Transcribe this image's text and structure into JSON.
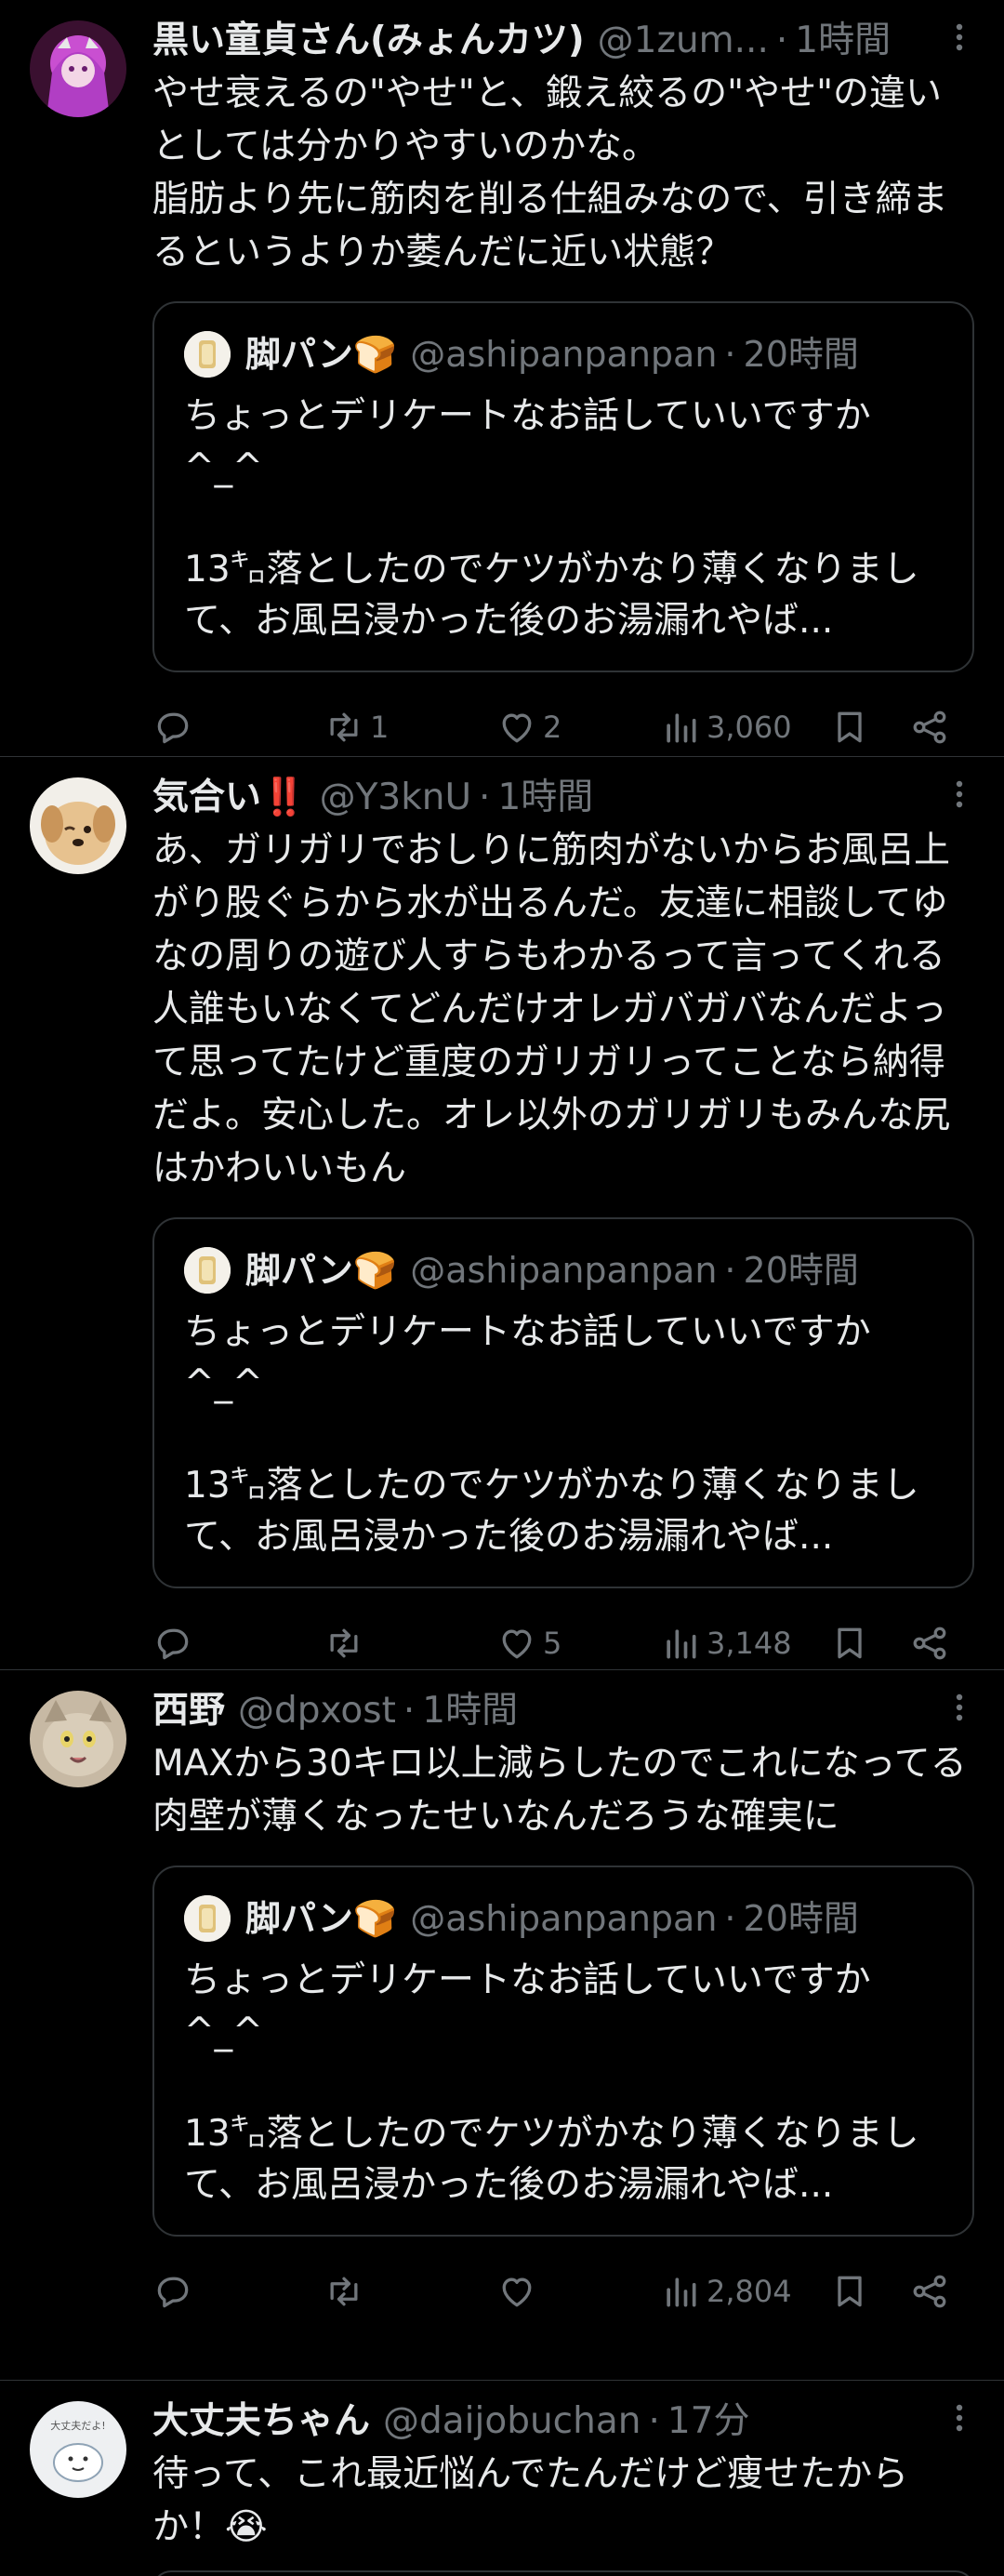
{
  "posts": [
    {
      "name": "黒い童貞さん(みょんカツ)",
      "handle": "@1zum...",
      "dot": "·",
      "time": "1時間",
      "text": "やせ衰えるの\"やせ\"と、鍛え絞るの\"やせ\"の違いとしては分かりやすいのかな。\n脂肪より先に筋肉を削る仕組みなので、引き締まるというよりか萎んだに近い状態？",
      "quote": {
        "name": "脚パン🍞",
        "handle": "@ashipanpanpan",
        "dot": "·",
        "time": "20時間",
        "text": "ちょっとデリケートなお話していいですか\n^_^\n\n13㌔落としたのでケツがかなり薄くなりまして、お風呂浸かった後のお湯漏れやば..."
      },
      "retweets": "1",
      "likes": "2",
      "views": "3,060"
    },
    {
      "name": "気合い‼️",
      "handle": "@Y3knU",
      "dot": "·",
      "time": "1時間",
      "text": "あ、ガリガリでおしりに筋肉がないからお風呂上がり股ぐらから水が出るんだ。友達に相談してゆなの周りの遊び人すらもわかるって言ってくれる人誰もいなくてどんだけオレガバガバなんだよって思ってたけど重度のガリガリってことなら納得だよ。安心した。オレ以外のガリガリもみんな尻はかわいいもん",
      "quote": {
        "name": "脚パン🍞",
        "handle": "@ashipanpanpan",
        "dot": "·",
        "time": "20時間",
        "text": "ちょっとデリケートなお話していいですか\n^_^\n\n13㌔落としたのでケツがかなり薄くなりまして、お風呂浸かった後のお湯漏れやば..."
      },
      "retweets": "",
      "likes": "5",
      "views": "3,148"
    },
    {
      "name": "西野",
      "handle": "@dpxost",
      "dot": "·",
      "time": "1時間",
      "text": "MAXから30キロ以上減らしたのでこれになってる　肉壁が薄くなったせいなんだろうな確実に",
      "quote": {
        "name": "脚パン🍞",
        "handle": "@ashipanpanpan",
        "dot": "·",
        "time": "20時間",
        "text": "ちょっとデリケートなお話していいですか\n^_^\n\n13㌔落としたのでケツがかなり薄くなりまして、お風呂浸かった後のお湯漏れやば..."
      },
      "retweets": "",
      "likes": "",
      "views": "2,804"
    },
    {
      "name": "大丈夫ちゃん",
      "handle": "@daijobuchan",
      "dot": "·",
      "time": "17分",
      "text": "待って、これ最近悩んでたんだけど痩せたからか！😭",
      "avatar_text": "大丈夫だよ!"
    }
  ],
  "colors": {
    "background": "#000000",
    "text": "#e7e9ea",
    "secondary": "#71767b",
    "border": "#2f3336"
  }
}
